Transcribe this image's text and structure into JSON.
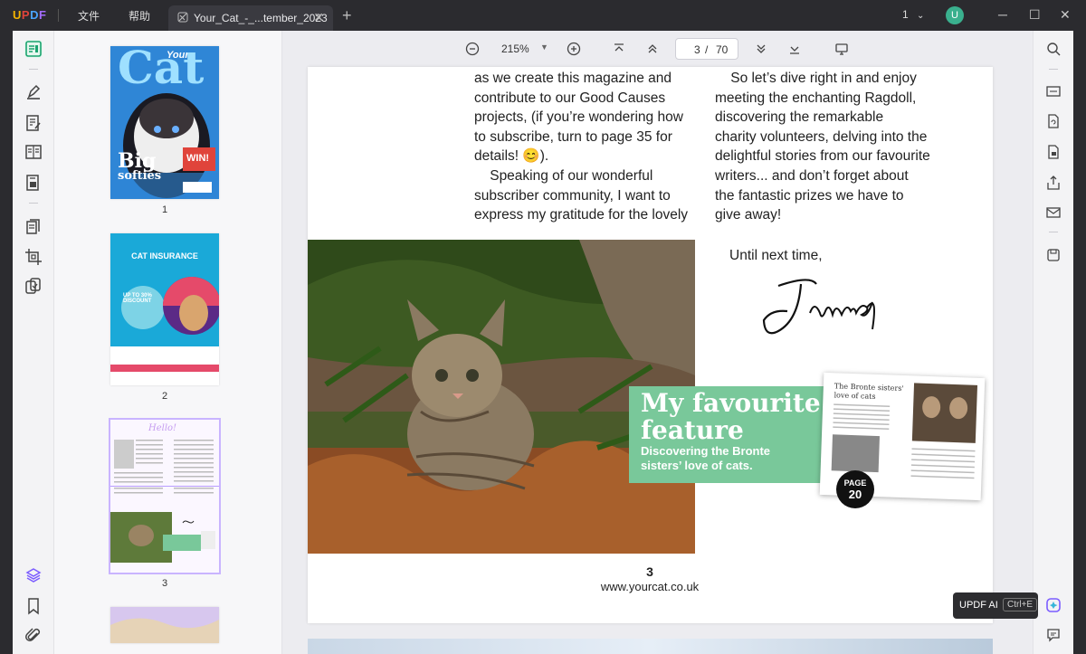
{
  "app": {
    "logo": "UPDF",
    "menus": [
      "文件",
      "帮助"
    ],
    "tab_title": "Your_Cat_-_...tember_2023",
    "tab_close": "✕",
    "new_tab": "+",
    "page_selector": "1",
    "avatar_letter": "U",
    "accent": "#3ab08e"
  },
  "toolbar": {
    "zoom": "215%",
    "current_page": "3",
    "page_sep": "/",
    "total_pages": "70"
  },
  "thumbnails": [
    {
      "label": "1",
      "cover_title": "Cat",
      "cover_sub": "Your",
      "cover_big": "Big",
      "cover_softies": "softies",
      "cover_win": "WIN!"
    },
    {
      "label": "2",
      "heading": "CAT INSURANCE",
      "offer": "UP TO 30% DISCOUNT"
    },
    {
      "label": "3",
      "hello": "Hello!"
    },
    {
      "label": ""
    }
  ],
  "page": {
    "left_col": [
      "as we create this magazine and",
      "contribute to our Good Causes",
      "projects, (if you’re wondering how",
      "to subscribe, turn to page 35 for",
      "details! 😊).",
      "    Speaking of our wonderful",
      "subscriber community, I want to",
      "express my gratitude for the lovely"
    ],
    "right_col": [
      "    So let’s dive right in and enjoy",
      "meeting the enchanting Ragdoll,",
      "discovering the remarkable",
      "charity volunteers, delving into the",
      "delightful stories from our favourite",
      "writers... and don’t forget about",
      "the fantastic prizes we have to",
      "give away!"
    ],
    "signoff": "Until next time,",
    "signature_name": "James",
    "feature_title_1": "My favourite",
    "feature_title_2": "feature",
    "feature_sub_1": "Discovering the Bronte",
    "feature_sub_2": "sisters’ love of cats.",
    "spread_heading_1": "The Bronte sisters'",
    "spread_heading_2": "love of cats",
    "badge_line_1": "PAGE",
    "badge_line_2": "20",
    "page_number": "3",
    "website": "www.yourcat.co.uk"
  },
  "ai": {
    "label": "UPDF AI",
    "shortcut": "Ctrl+E"
  },
  "icons": {
    "left": [
      "reader-icon",
      "highlighter-icon",
      "edit-text-icon",
      "form-icon",
      "fill-sign-icon",
      "organize-pages-icon",
      "crop-icon",
      "compare-icon",
      "layers-icon",
      "bookmark-icon",
      "attachment-icon"
    ],
    "right": [
      "search-icon",
      "ocr-icon",
      "convert-icon",
      "protect-icon",
      "share-icon",
      "email-icon",
      "save-icon",
      "ai-icon",
      "comment-icon"
    ]
  }
}
